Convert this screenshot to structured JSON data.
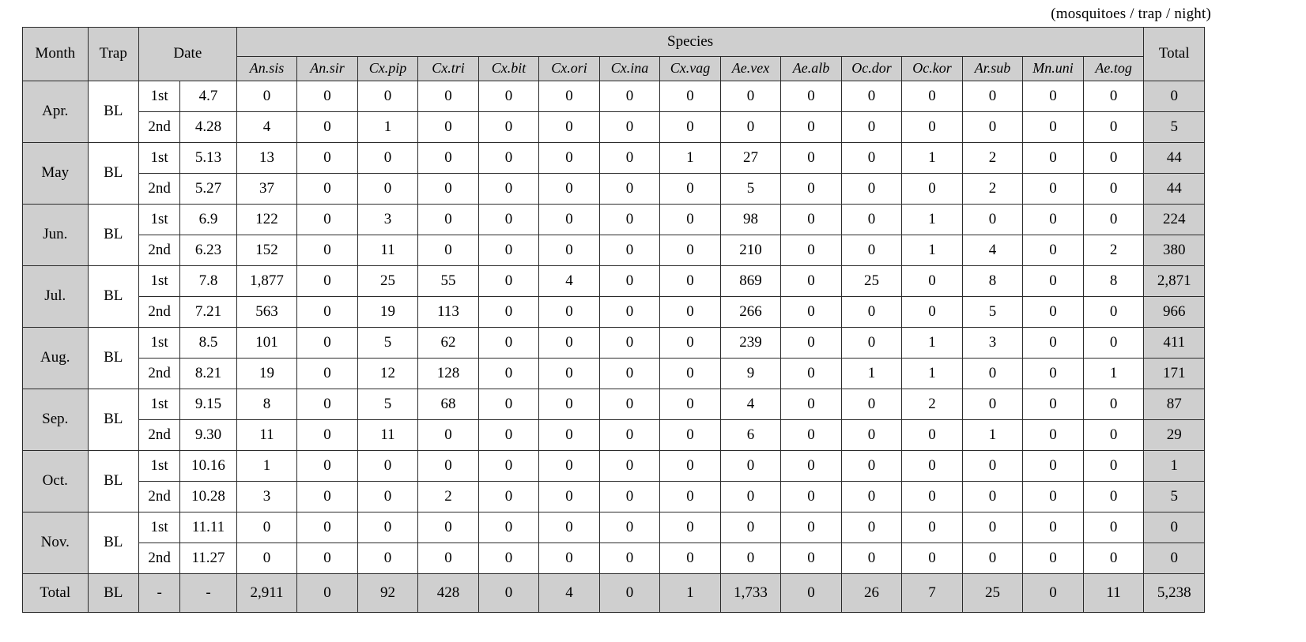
{
  "unit_note": "(mosquitoes / trap / night)",
  "header": {
    "month": "Month",
    "trap": "Trap",
    "date": "Date",
    "species_group": "Species",
    "total": "Total",
    "species": [
      "An.sis",
      "An.sir",
      "Cx.pip",
      "Cx.tri",
      "Cx.bit",
      "Cx.ori",
      "Cx.ina",
      "Cx.vag",
      "Ae.vex",
      "Ae.alb",
      "Oc.dor",
      "Oc.kor",
      "Ar.sub",
      "Mn.uni",
      "Ae.tog"
    ]
  },
  "colors": {
    "header_bg": "#cfcfcf",
    "shaded_bg": "#cfcfcf",
    "cell_bg": "#ffffff",
    "border": "#2b2b2b"
  },
  "rows": [
    {
      "month": "Apr.",
      "trap": "BL",
      "ordinal": "1st",
      "date": "4.7",
      "values": [
        0,
        0,
        0,
        0,
        0,
        0,
        0,
        0,
        0,
        0,
        0,
        0,
        0,
        0,
        0
      ],
      "total": "0"
    },
    {
      "month": "Apr.",
      "trap": "BL",
      "ordinal": "2nd",
      "date": "4.28",
      "values": [
        4,
        0,
        1,
        0,
        0,
        0,
        0,
        0,
        0,
        0,
        0,
        0,
        0,
        0,
        0
      ],
      "total": "5"
    },
    {
      "month": "May",
      "trap": "BL",
      "ordinal": "1st",
      "date": "5.13",
      "values": [
        13,
        0,
        0,
        0,
        0,
        0,
        0,
        1,
        27,
        0,
        0,
        1,
        2,
        0,
        0
      ],
      "total": "44"
    },
    {
      "month": "May",
      "trap": "BL",
      "ordinal": "2nd",
      "date": "5.27",
      "values": [
        37,
        0,
        0,
        0,
        0,
        0,
        0,
        0,
        5,
        0,
        0,
        0,
        2,
        0,
        0
      ],
      "total": "44"
    },
    {
      "month": "Jun.",
      "trap": "BL",
      "ordinal": "1st",
      "date": "6.9",
      "values": [
        122,
        0,
        3,
        0,
        0,
        0,
        0,
        0,
        98,
        0,
        0,
        1,
        0,
        0,
        0
      ],
      "total": "224"
    },
    {
      "month": "Jun.",
      "trap": "BL",
      "ordinal": "2nd",
      "date": "6.23",
      "values": [
        152,
        0,
        11,
        0,
        0,
        0,
        0,
        0,
        210,
        0,
        0,
        1,
        4,
        0,
        2
      ],
      "total": "380"
    },
    {
      "month": "Jul.",
      "trap": "BL",
      "ordinal": "1st",
      "date": "7.8",
      "values": [
        "1,877",
        0,
        25,
        55,
        0,
        4,
        0,
        0,
        869,
        0,
        25,
        0,
        8,
        0,
        8
      ],
      "total": "2,871"
    },
    {
      "month": "Jul.",
      "trap": "BL",
      "ordinal": "2nd",
      "date": "7.21",
      "values": [
        563,
        0,
        19,
        113,
        0,
        0,
        0,
        0,
        266,
        0,
        0,
        0,
        5,
        0,
        0
      ],
      "total": "966"
    },
    {
      "month": "Aug.",
      "trap": "BL",
      "ordinal": "1st",
      "date": "8.5",
      "values": [
        101,
        0,
        5,
        62,
        0,
        0,
        0,
        0,
        239,
        0,
        0,
        1,
        3,
        0,
        0
      ],
      "total": "411"
    },
    {
      "month": "Aug.",
      "trap": "BL",
      "ordinal": "2nd",
      "date": "8.21",
      "values": [
        19,
        0,
        12,
        128,
        0,
        0,
        0,
        0,
        9,
        0,
        1,
        1,
        0,
        0,
        1
      ],
      "total": "171"
    },
    {
      "month": "Sep.",
      "trap": "BL",
      "ordinal": "1st",
      "date": "9.15",
      "values": [
        8,
        0,
        5,
        68,
        0,
        0,
        0,
        0,
        4,
        0,
        0,
        2,
        0,
        0,
        0
      ],
      "total": "87"
    },
    {
      "month": "Sep.",
      "trap": "BL",
      "ordinal": "2nd",
      "date": "9.30",
      "values": [
        11,
        0,
        11,
        0,
        0,
        0,
        0,
        0,
        6,
        0,
        0,
        0,
        1,
        0,
        0
      ],
      "total": "29"
    },
    {
      "month": "Oct.",
      "trap": "BL",
      "ordinal": "1st",
      "date": "10.16",
      "values": [
        1,
        0,
        0,
        0,
        0,
        0,
        0,
        0,
        0,
        0,
        0,
        0,
        0,
        0,
        0
      ],
      "total": "1"
    },
    {
      "month": "Oct.",
      "trap": "BL",
      "ordinal": "2nd",
      "date": "10.28",
      "values": [
        3,
        0,
        0,
        2,
        0,
        0,
        0,
        0,
        0,
        0,
        0,
        0,
        0,
        0,
        0
      ],
      "total": "5"
    },
    {
      "month": "Nov.",
      "trap": "BL",
      "ordinal": "1st",
      "date": "11.11",
      "values": [
        0,
        0,
        0,
        0,
        0,
        0,
        0,
        0,
        0,
        0,
        0,
        0,
        0,
        0,
        0
      ],
      "total": "0"
    },
    {
      "month": "Nov.",
      "trap": "BL",
      "ordinal": "2nd",
      "date": "11.27",
      "values": [
        0,
        0,
        0,
        0,
        0,
        0,
        0,
        0,
        0,
        0,
        0,
        0,
        0,
        0,
        0
      ],
      "total": "0"
    }
  ],
  "total_row": {
    "month": "Total",
    "trap": "BL",
    "ordinal": "-",
    "date": "-",
    "values": [
      "2,911",
      0,
      92,
      428,
      0,
      4,
      0,
      1,
      "1,733",
      0,
      26,
      7,
      25,
      0,
      11
    ],
    "total": "5,238"
  }
}
